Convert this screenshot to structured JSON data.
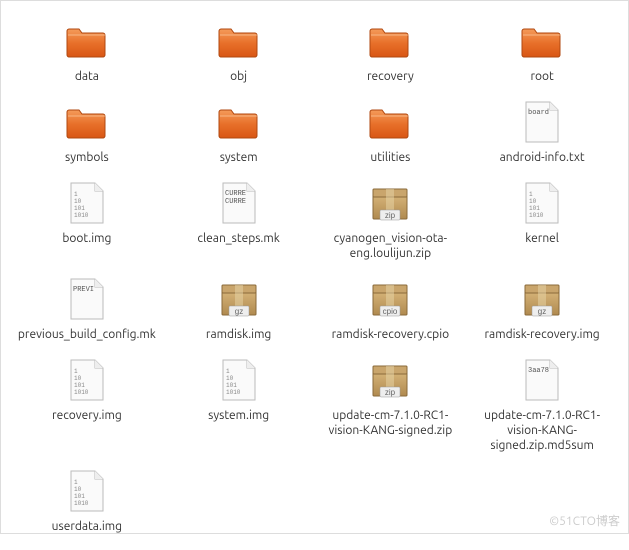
{
  "watermark": "©51CTO博客",
  "items": [
    {
      "type": "folder",
      "name": "data",
      "thumb": ""
    },
    {
      "type": "folder",
      "name": "obj",
      "thumb": ""
    },
    {
      "type": "folder",
      "name": "recovery",
      "thumb": ""
    },
    {
      "type": "folder",
      "name": "root",
      "thumb": ""
    },
    {
      "type": "folder",
      "name": "symbols",
      "thumb": ""
    },
    {
      "type": "folder",
      "name": "system",
      "thumb": ""
    },
    {
      "type": "folder",
      "name": "utilities",
      "thumb": ""
    },
    {
      "type": "text",
      "name": "android-info.txt",
      "thumb": "board"
    },
    {
      "type": "binary",
      "name": "boot.img",
      "thumb": ""
    },
    {
      "type": "text",
      "name": "clean_steps.mk",
      "thumb": "CURRE\nCURRE"
    },
    {
      "type": "zip",
      "name": "cyanogen_vision-ota-eng.loulijun.zip",
      "thumb": ""
    },
    {
      "type": "binary",
      "name": "kernel",
      "thumb": ""
    },
    {
      "type": "text",
      "name": "previous_build_config.mk",
      "thumb": "PREVI"
    },
    {
      "type": "gz",
      "name": "ramdisk.img",
      "thumb": ""
    },
    {
      "type": "cpio",
      "name": "ramdisk-recovery.cpio",
      "thumb": ""
    },
    {
      "type": "gz",
      "name": "ramdisk-recovery.img",
      "thumb": ""
    },
    {
      "type": "binary",
      "name": "recovery.img",
      "thumb": ""
    },
    {
      "type": "binary",
      "name": "system.img",
      "thumb": ""
    },
    {
      "type": "zip",
      "name": "update-cm-7.1.0-RC1-vision-KANG-signed.zip",
      "thumb": ""
    },
    {
      "type": "text",
      "name": "update-cm-7.1.0-RC1-vision-KANG-signed.zip.md5sum",
      "thumb": "3aa78"
    },
    {
      "type": "binary",
      "name": "userdata.img",
      "thumb": ""
    }
  ]
}
